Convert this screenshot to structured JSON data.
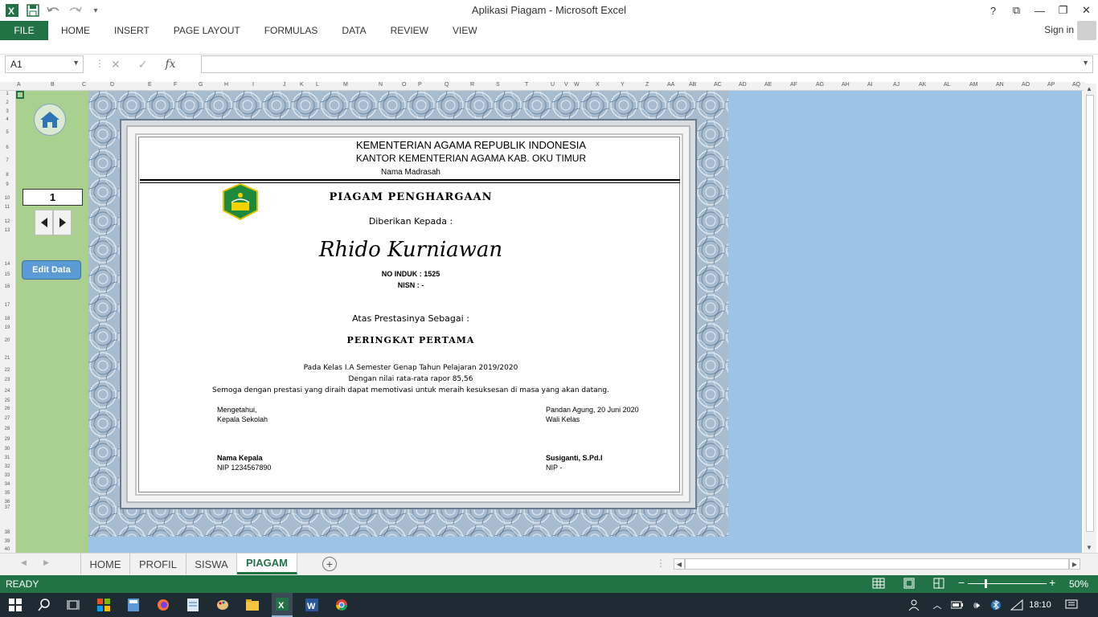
{
  "window": {
    "title": "Aplikasi Piagam - Microsoft Excel"
  },
  "ribbon": {
    "file": "FILE",
    "tabs": [
      "HOME",
      "INSERT",
      "PAGE LAYOUT",
      "FORMULAS",
      "DATA",
      "REVIEW",
      "VIEW"
    ],
    "sign_in": "Sign in"
  },
  "formula_bar": {
    "name_box": "A1",
    "fx": "fx",
    "value": ""
  },
  "columns": [
    "A",
    "B",
    "C",
    "D",
    "E",
    "F",
    "G",
    "H",
    "I",
    "J",
    "K",
    "L",
    "M",
    "N",
    "O",
    "P",
    "Q",
    "R",
    "S",
    "T",
    "U",
    "V",
    "W",
    "X",
    "Y",
    "Z",
    "AA",
    "AB",
    "AC",
    "AD",
    "AE",
    "AF",
    "AG",
    "AH",
    "AI",
    "AJ",
    "AK",
    "AL",
    "AM",
    "AN",
    "AO",
    "AP",
    "AQ"
  ],
  "rows": [
    "1",
    "2",
    "3",
    "4",
    "5",
    "6",
    "7",
    "8",
    "9",
    "10",
    "11",
    "12",
    "13",
    "14",
    "15",
    "16",
    "17",
    "18",
    "19",
    "20",
    "21",
    "22",
    "23",
    "24",
    "25",
    "26",
    "27",
    "28",
    "29",
    "30",
    "31",
    "32",
    "33",
    "34",
    "35",
    "36",
    "37",
    "38",
    "39",
    "40"
  ],
  "panel": {
    "record_number": "1",
    "edit_button": "Edit Data"
  },
  "certificate": {
    "ministry": "KEMENTERIAN AGAMA REPUBLIK INDONESIA",
    "office": "KANTOR KEMENTERIAN AGAMA KAB. OKU TIMUR",
    "school": "Nama Madrasah",
    "heading": "PIAGAM PENGHARGAAN",
    "given_to": "Diberikan Kepada :",
    "recipient": "Rhido Kurniawan",
    "no_induk": "NO INDUK : 1525",
    "nisn": "NISN : -",
    "achievement_intro": "Atas Prestasinya Sebagai :",
    "achievement": "PERINGKAT PERTAMA",
    "line1": "Pada Kelas I.A Semester Genap Tahun Pelajaran 2019/2020",
    "line2": "Dengan nilai rata-rata rapor 85,56",
    "line3": "Semoga dengan prestasi yang diraih dapat memotivasi untuk meraih kesuksesan di masa yang akan datang.",
    "left_sig": {
      "l1": "Mengetahui,",
      "l2": "Kepala Sekolah",
      "name": "Nama Kepala",
      "nip": "NIP 1234567890"
    },
    "right_sig": {
      "l1": "Pandan Agung, 20 Juni 2020",
      "l2": "Wali Kelas",
      "name": "Susiganti, S.Pd.I",
      "nip": "NIP -"
    }
  },
  "sheets": [
    "HOME",
    "PROFIL",
    "SISWA",
    "PIAGAM"
  ],
  "active_sheet": "PIAGAM",
  "status": {
    "ready": "READY",
    "zoom": "50%"
  },
  "taskbar": {
    "time": "18:10"
  },
  "colors": {
    "excel_green": "#217346",
    "panel_green": "#a9d08e",
    "sheet_blue": "#9dc3e6",
    "button_blue": "#5b9bd5"
  }
}
